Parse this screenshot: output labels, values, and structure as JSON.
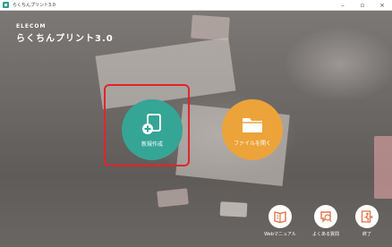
{
  "window": {
    "title": "らくちんプリント3.0",
    "controls": {
      "minimize": "–",
      "maximize": "▫",
      "close": "×"
    }
  },
  "brand": {
    "maker": "ELECOM",
    "product": "らくちんプリント3.0"
  },
  "actions": {
    "new": {
      "label": "新規作成",
      "icon": "new-document-icon",
      "color": "#35a596"
    },
    "open": {
      "label": "ファイルを開く",
      "icon": "folder-icon",
      "color": "#eca33a"
    }
  },
  "footer": {
    "manual": {
      "label": "Webマニュアル",
      "icon": "manual-book-icon"
    },
    "faq": {
      "label": "よくある質問",
      "icon": "faq-icon"
    },
    "exit": {
      "label": "終了",
      "icon": "exit-icon"
    }
  },
  "highlight_color": "#e3242b"
}
